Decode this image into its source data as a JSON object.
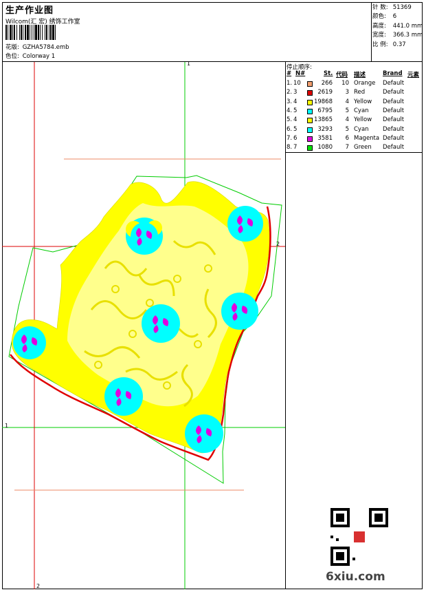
{
  "header": {
    "title": "生产作业图",
    "subtitle": "Wilcom(汇 宏) 绣饰工作室",
    "design_label": "花版:",
    "design_value": "GZHA5784.emb",
    "colorway_label": "色位:",
    "colorway_value": "Colorway 1"
  },
  "stats": [
    {
      "label": "针 数:",
      "value": "51369"
    },
    {
      "label": "颜色:",
      "value": "6"
    },
    {
      "label": "高度:",
      "value": "441.0 mm"
    },
    {
      "label": "宽度:",
      "value": "366.3 mm"
    },
    {
      "label": "比 例:",
      "value": "0.37"
    }
  ],
  "color_table": {
    "title": "停止顺序:",
    "headers": [
      "#",
      "N#",
      "St.",
      "代码",
      "描述",
      "Brand",
      "元素"
    ],
    "rows": [
      {
        "index": "1.",
        "n": "10",
        "color": "#f4a070",
        "stitches": "266",
        "code": "10",
        "desc": "Orange",
        "brand": "Default"
      },
      {
        "index": "2.",
        "n": "3",
        "color": "#e00000",
        "stitches": "2619",
        "code": "3",
        "desc": "Red",
        "brand": "Default"
      },
      {
        "index": "3.",
        "n": "4",
        "color": "#ffff00",
        "stitches": "19868",
        "code": "4",
        "desc": "Yellow",
        "brand": "Default"
      },
      {
        "index": "4.",
        "n": "5",
        "color": "#00ffff",
        "stitches": "6795",
        "code": "5",
        "desc": "Cyan",
        "brand": "Default"
      },
      {
        "index": "5.",
        "n": "4",
        "color": "#ffff00",
        "stitches": "13865",
        "code": "4",
        "desc": "Yellow",
        "brand": "Default"
      },
      {
        "index": "6.",
        "n": "5",
        "color": "#00ffff",
        "stitches": "3293",
        "code": "5",
        "desc": "Cyan",
        "brand": "Default"
      },
      {
        "index": "7.",
        "n": "6",
        "color": "#e000e0",
        "stitches": "3581",
        "code": "6",
        "desc": "Magenta",
        "brand": "Default"
      },
      {
        "index": "8.",
        "n": "7",
        "color": "#00e000",
        "stitches": "1080",
        "code": "7",
        "desc": "Green",
        "brand": "Default"
      }
    ]
  },
  "canvas": {
    "guide_labels": [
      "1",
      "2",
      "1",
      "2"
    ],
    "colors": {
      "guide_green": "#00cc00",
      "guide_red": "#dd0000",
      "fill_yellow": "#ffff00",
      "cyan": "#00ffff",
      "magenta": "#e000e0",
      "edge_red": "#e00000"
    }
  },
  "watermark": "6xiu.com"
}
